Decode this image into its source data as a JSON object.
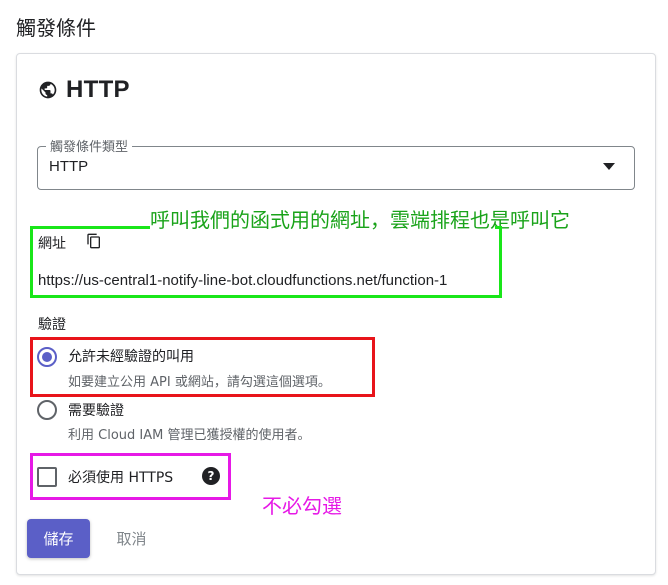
{
  "page": {
    "title": "觸發條件"
  },
  "card": {
    "header_title": "HTTP",
    "header_icon": "globe-icon"
  },
  "trigger_type": {
    "label": "觸發條件類型",
    "value": "HTTP"
  },
  "url": {
    "label": "網址",
    "value": "https://us-central1-notify-line-bot.cloudfunctions.net/function-1",
    "copy_icon": "copy-icon"
  },
  "authentication": {
    "label": "驗證",
    "options": [
      {
        "title": "允許未經驗證的叫用",
        "description": "如要建立公用 API 或網站，請勾選這個選項。",
        "selected": true
      },
      {
        "title": "需要驗證",
        "description": "利用 Cloud IAM 管理已獲授權的使用者。",
        "selected": false
      }
    ]
  },
  "require_https": {
    "label": "必須使用 HTTPS",
    "checked": false,
    "help_icon": "help-icon"
  },
  "annotations": {
    "green": "呼叫我們的函式用的網址，雲端排程也是呼叫它",
    "magenta": "不必勾選",
    "colors": {
      "green": "#19e619",
      "red": "#e8141a",
      "magenta": "#e619e6"
    }
  },
  "actions": {
    "save_label": "儲存",
    "cancel_label": "取消"
  },
  "colors": {
    "accent": "#5b5fc7"
  }
}
